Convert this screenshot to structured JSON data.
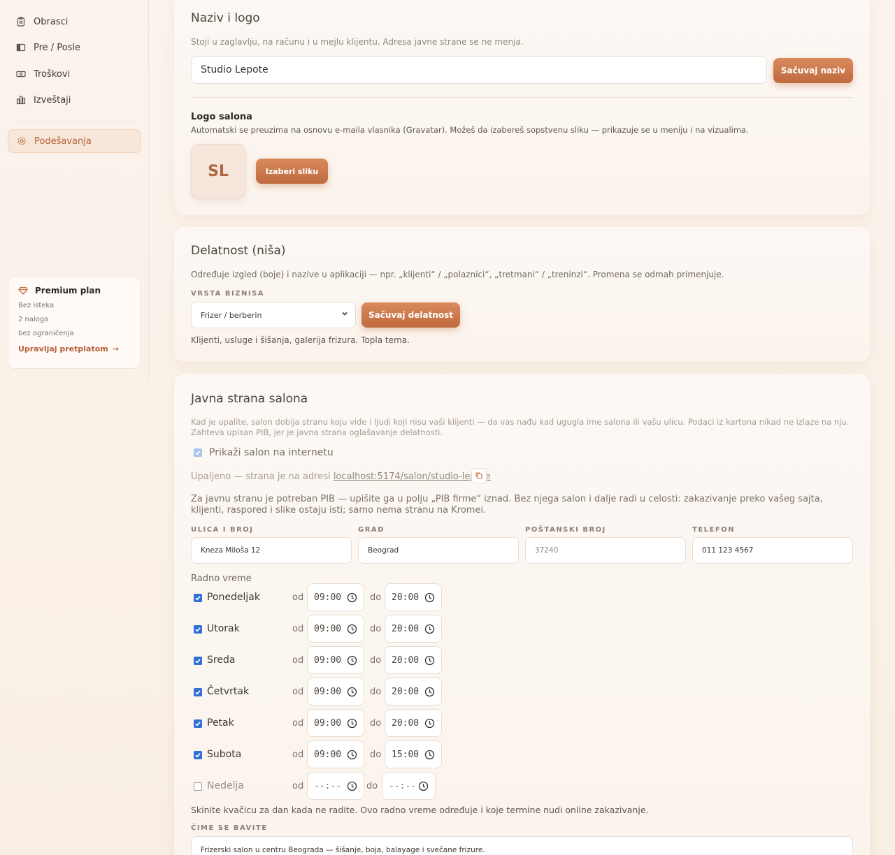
{
  "sidebar": {
    "items": [
      {
        "label": "Obrasci",
        "icon": "clipboard-icon"
      },
      {
        "label": "Pre / Posle",
        "icon": "before-after-icon"
      },
      {
        "label": "Troškovi",
        "icon": "banknote-icon"
      },
      {
        "label": "Izveštaji",
        "icon": "bar-chart-icon"
      }
    ],
    "active": {
      "label": "Podešavanja",
      "icon": "gear-icon"
    },
    "premium": {
      "title": "Premium plan",
      "lines": [
        "Bez isteka",
        "2 naloga",
        "bez ograničenja"
      ],
      "link": "Upravljaj pretplatom"
    }
  },
  "name_logo": {
    "title": "Naziv i logo",
    "desc": "Stoji u zaglavlju, na računu i u mejlu klijentu. Adresa javne strane se ne menja.",
    "name_value": "Studio Lepote",
    "save_label": "Sačuvaj naziv",
    "logo_title": "Logo salona",
    "logo_desc": "Automatski se preuzima na osnovu e-maila vlasnika (Gravatar). Možeš da izabereš sopstvenu sliku — prikazuje se u meniju i na vizualima.",
    "avatar_initials": "SL",
    "choose_label": "Izaberi sliku"
  },
  "niche": {
    "title": "Delatnost (niša)",
    "desc": "Određuje izgled (boje) i nazive u aplikaciji — npr. „klijenti“ / „polaznici“, „tretmani“ / „treninzi“. Promena se odmah primenjuje.",
    "type_label": "VRSTA BIZNISA",
    "selected": "Frizer / berberin",
    "save_label": "Sačuvaj delatnost",
    "hint": "Klijenti, usluge i šišanja, galerija frizura. Topla tema."
  },
  "public": {
    "title": "Javna strana salona",
    "desc": "Kad je upalite, salon dobija stranu koju vide i ljudi koji nisu vaši klijenti — da vas nađu kad ugugla ime salona ili vašu ulicu. Podaci iz kartona nikad ne izlaze na nju. Zahteva upisan PIB, jer je javna strana oglašavanje delatnosti.",
    "show_label": "Prikaži salon na internetu",
    "status_prefix": "Upaljeno — strana je na adresi",
    "url": "localhost:5174/salon/studio-lepote",
    "pib_note": "Za javnu stranu je potreban PIB — upišite ga u polju „PIB firme“ iznad. Bez njega salon i dalje radi u celosti: zakazivanje preko vašeg sajta, klijenti, raspored i slike ostaju isti; samo nema stranu na Kromei.",
    "fields": {
      "street_label": "ULICA I BROJ",
      "street_value": "Kneza Miloša 12",
      "city_label": "GRAD",
      "city_value": "Beograd",
      "postal_label": "POŠTANSKI BROJ",
      "postal_placeholder": "37240",
      "phone_label": "TELEFON",
      "phone_value": "011 123 4567"
    },
    "hours_label": "Radno vreme",
    "od": "od",
    "do": "do",
    "days": [
      {
        "name": "Ponedeljak",
        "checked": true,
        "from": "09:00",
        "to": "20:00"
      },
      {
        "name": "Utorak",
        "checked": true,
        "from": "09:00",
        "to": "20:00"
      },
      {
        "name": "Sreda",
        "checked": true,
        "from": "09:00",
        "to": "20:00"
      },
      {
        "name": "Četvrtak",
        "checked": true,
        "from": "09:00",
        "to": "20:00"
      },
      {
        "name": "Petak",
        "checked": true,
        "from": "09:00",
        "to": "20:00"
      },
      {
        "name": "Subota",
        "checked": true,
        "from": "09:00",
        "to": "15:00"
      },
      {
        "name": "Nedelja",
        "checked": false,
        "from": "--:--",
        "to": "--:--"
      }
    ],
    "hours_hint": "Skinite kvačicu za dan kada ne radite. Ovo radno vreme određuje i koje termine nudi online zakazivanje.",
    "about_label": "ČIME SE BAVITE",
    "about_value": "Frizerski salon u centru Beograda — šišanje, boja, balayage i svečane frizure."
  },
  "colors": {
    "accent": "#c4703f",
    "check": "#2f6fd6"
  }
}
